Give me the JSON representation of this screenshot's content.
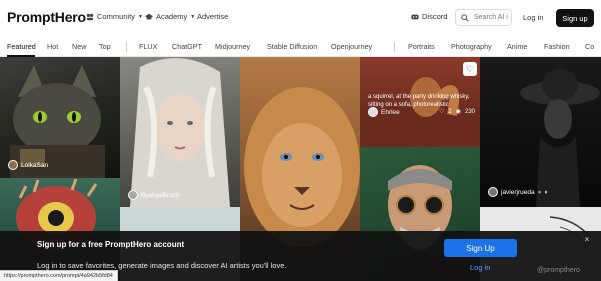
{
  "header": {
    "logo": "PromptHero",
    "community": "Community",
    "academy": "Academy",
    "advertise": "Advertise",
    "discord": "Discord",
    "search_placeholder": "Search AI i",
    "login": "Log in",
    "signup": "Sign up"
  },
  "tabs": [
    {
      "label": "Featured"
    },
    {
      "label": "Hot"
    },
    {
      "label": "New"
    },
    {
      "label": "Top"
    },
    {
      "label": "FLUX"
    },
    {
      "label": "ChatGPT"
    },
    {
      "label": "Midjourney"
    },
    {
      "label": "Stable Diffusion"
    },
    {
      "label": "Openjourney"
    },
    {
      "label": "Portraits"
    },
    {
      "label": "Photography"
    },
    {
      "label": "Anime"
    },
    {
      "label": "Fashion"
    },
    {
      "label": "Co"
    }
  ],
  "gallery": {
    "user_lolkasan": "LolkaSan",
    "user_byebye": "ByebyeBrazil",
    "user_ehrlee": "Ehrlee",
    "user_javier": "javierjrueda",
    "prompt_text_line1": "a squirrel, at the party drinking whisky,",
    "prompt_text_line2": "sitting on a sofa, photorealistic",
    "likes": "2",
    "views": "230"
  },
  "banner": {
    "title": "Sign up for a free PromptHero account",
    "text": "Log in to save favorites, generate images and discover AI artists you'll love.",
    "signup": "Sign Up",
    "login": "Log in",
    "close": "×"
  },
  "statusbar": {
    "url": "https://prompthero.com/prompt/4a942b5fd84"
  },
  "watermark": "@prompthero",
  "colors": {
    "accent": "#1a73e8",
    "dark": "#111111"
  }
}
